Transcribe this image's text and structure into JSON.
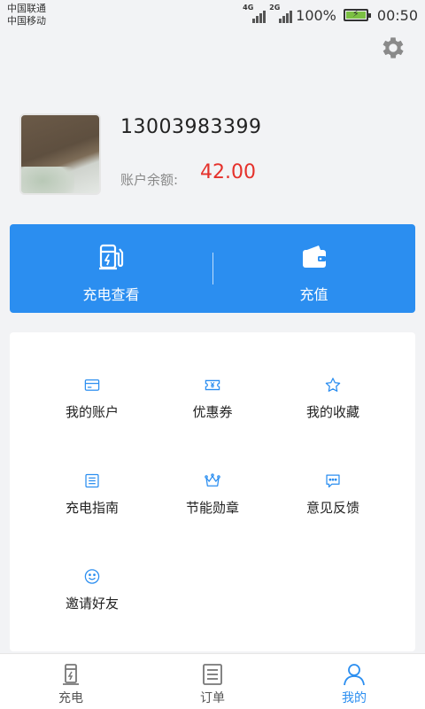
{
  "status_bar": {
    "carrier1": "中国联通",
    "carrier2": "中国移动",
    "network1": "4G",
    "network2": "2G",
    "battery_text": "100%",
    "battery_level": 1.0,
    "time": "00:50"
  },
  "profile": {
    "phone": "13003983399",
    "balance_label": "账户余额:",
    "balance_value": "42.00"
  },
  "actions": [
    {
      "label": "充电查看",
      "icon": "charging-station-icon"
    },
    {
      "label": "充值",
      "icon": "wallet-icon"
    }
  ],
  "menu": [
    {
      "label": "我的账户",
      "icon": "card-icon"
    },
    {
      "label": "优惠券",
      "icon": "coupon-icon"
    },
    {
      "label": "我的收藏",
      "icon": "star-icon"
    },
    {
      "label": "充电指南",
      "icon": "guide-icon"
    },
    {
      "label": "节能勋章",
      "icon": "crown-icon"
    },
    {
      "label": "意见反馈",
      "icon": "feedback-icon"
    },
    {
      "label": "邀请好友",
      "icon": "smile-icon"
    }
  ],
  "bottom_nav": {
    "items": [
      {
        "label": "充电",
        "icon": "charger-icon"
      },
      {
        "label": "订单",
        "icon": "order-list-icon"
      },
      {
        "label": "我的",
        "icon": "person-icon"
      }
    ],
    "active_index": 2
  },
  "colors": {
    "accent": "#2b8ef0",
    "balance": "#e5312b",
    "background": "#f2f3f5",
    "battery": "#7bc043"
  }
}
